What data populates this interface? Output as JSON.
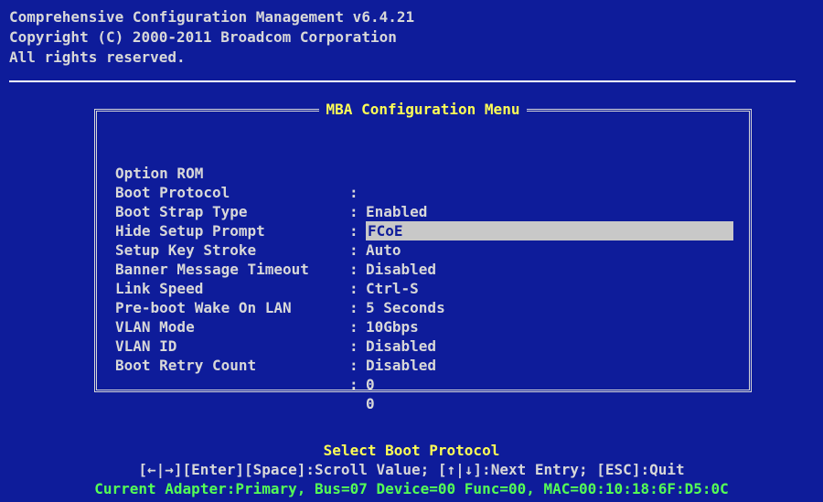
{
  "header": {
    "lines": [
      "Comprehensive Configuration Management v6.4.21",
      "Copyright (C) 2000-2011 Broadcom Corporation",
      "All rights reserved."
    ]
  },
  "menu": {
    "title": "MBA Configuration Menu",
    "items": [
      {
        "label": "Option ROM",
        "value": "Enabled"
      },
      {
        "label": "Boot Protocol",
        "value": "FCoE",
        "selected": true
      },
      {
        "label": "Boot Strap Type",
        "value": "Auto"
      },
      {
        "label": "Hide Setup Prompt",
        "value": "Disabled"
      },
      {
        "label": "Setup Key Stroke",
        "value": "Ctrl-S"
      },
      {
        "label": "Banner Message Timeout",
        "value": "5 Seconds"
      },
      {
        "label": "Link Speed",
        "value": "10Gbps"
      },
      {
        "label": "Pre-boot Wake On LAN",
        "value": "Disabled"
      },
      {
        "label": "VLAN Mode",
        "value": "Disabled"
      },
      {
        "label": "VLAN ID",
        "value": "0"
      },
      {
        "label": "Boot Retry Count",
        "value": "0"
      }
    ]
  },
  "footer": {
    "prompt": "Select Boot Protocol",
    "keys": "[←|→][Enter][Space]:Scroll Value; [↑|↓]:Next Entry; [ESC]:Quit",
    "adapter": "Current Adapter:Primary, Bus=07 Device=00 Func=00, MAC=00:10:18:6F:D5:0C"
  },
  "colors": {
    "background": "#0e1c9a",
    "text": "#d8d8d8",
    "title": "#ffff55",
    "highlight": "#c8c8c8",
    "adapter": "#55ff55"
  }
}
